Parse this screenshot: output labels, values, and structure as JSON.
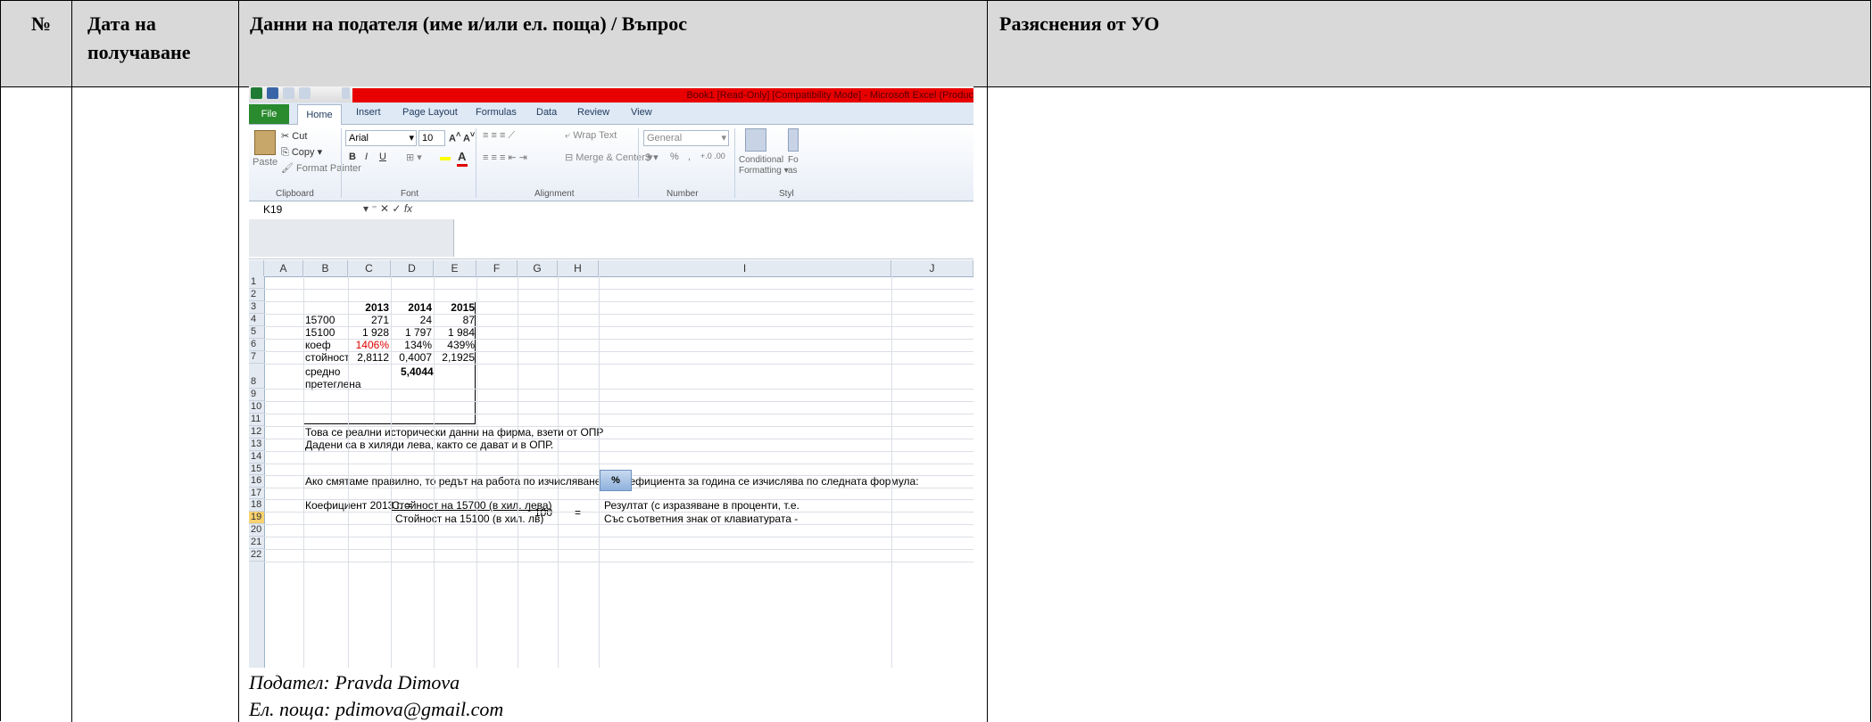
{
  "header": {
    "col_no": "№",
    "col_date": "Дата на получаване",
    "col_question": "Данни на подателя (име и/или ел. поща) / Въпрос",
    "col_answer": "Разяснения от УО"
  },
  "excel": {
    "title": "Book1 [Read-Only] [Compatibility Mode] - Microsoft Excel (Produc",
    "tabs": [
      "File",
      "Home",
      "Insert",
      "Page Layout",
      "Formulas",
      "Data",
      "Review",
      "View"
    ],
    "clipboard": {
      "cut": "Cut",
      "copy": "Copy ▾",
      "paste": "Paste",
      "format_painter": "Format Painter",
      "label": "Clipboard"
    },
    "font": {
      "name": "Arial",
      "size": "10",
      "label": "Font",
      "bold": "B",
      "italic": "I",
      "underline": "U"
    },
    "alignment": {
      "wrap": "Wrap Text",
      "merge": "Merge & Center ▾",
      "label": "Alignment"
    },
    "number": {
      "format": "General",
      "pct": "%",
      "comma": ",",
      "label": "Number"
    },
    "styles": {
      "cond": "Conditional",
      "cond2": "Formatting ▾",
      "fo": "Fo",
      "as": "as",
      "label": "Styl"
    },
    "name_box": "K19",
    "fx": "fx",
    "columns": [
      "A",
      "B",
      "C",
      "D",
      "E",
      "F",
      "G",
      "H",
      "I",
      "J"
    ],
    "rows": [
      "1",
      "2",
      "3",
      "4",
      "5",
      "6",
      "7",
      "8",
      "9",
      "10",
      "11",
      "12",
      "13",
      "14",
      "15",
      "16",
      "17",
      "18",
      "19",
      "20",
      "21",
      "22"
    ],
    "table": {
      "years": [
        "2013",
        "2014",
        "2015"
      ],
      "r4": {
        "label": "15700",
        "v": [
          "271",
          "24",
          "87"
        ]
      },
      "r5": {
        "label": "15100",
        "v": [
          "1 928",
          "1 797",
          "1 984"
        ]
      },
      "r6": {
        "label": "коеф",
        "v": [
          "1406%",
          "134%",
          "439%"
        ]
      },
      "r7": {
        "label": "стойност",
        "v": [
          "2,8112",
          "0,4007",
          "2,1925"
        ]
      },
      "r8": {
        "label1": "средно",
        "label2": "претеглена",
        "v": "5,4044"
      }
    },
    "notes": {
      "r12": "Това се реални исторически данни на фирма, взети от ОПР",
      "r13": "Дадени са в хиляди лева, както се дават и в ОПР.",
      "r16": "Ако смятаме правилно, то редът на работа по изчисляване на коефициента за година се изчислява по следната формула:",
      "r18_label": "Коефициент 2013 г. =",
      "numerator": "Стойност на 15700 (в хил. лева)",
      "denominator": "Стойност на 15100 (в хил. лв)",
      "times": "* 100",
      "eq": "=",
      "result1": "Резултат (с изразяване в проценти, т.е.",
      "result2": "Със съответния знак от клавиатурата -",
      "pct_button": "%"
    }
  },
  "sender": {
    "name_line": "Подател: Pravda Dimova",
    "email_line": "Ел. поща: pdimova@gmail.com"
  }
}
